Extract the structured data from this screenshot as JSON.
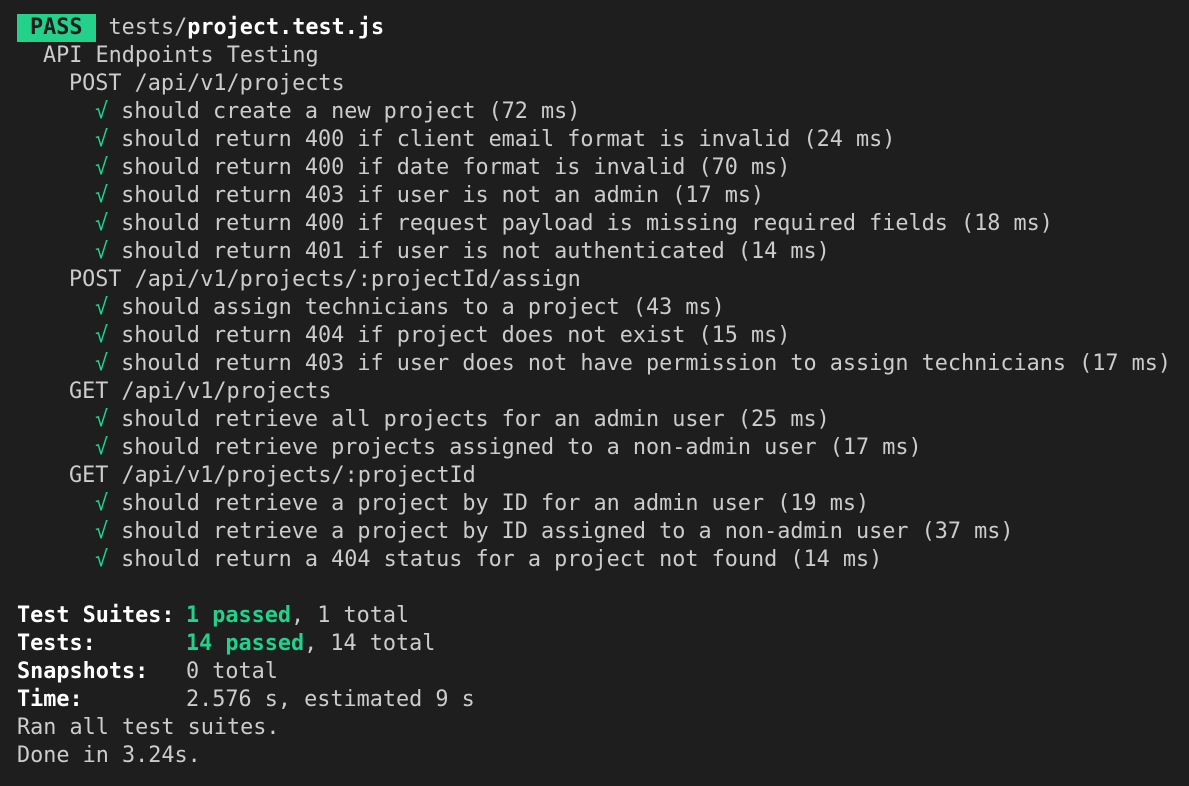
{
  "header": {
    "status": "PASS",
    "file_dir": "tests/",
    "file_name": "project.test.js"
  },
  "suite_title": "API Endpoints Testing",
  "check_glyph": "√",
  "groups": [
    {
      "title": "POST /api/v1/projects",
      "tests": [
        "should create a new project (72 ms)",
        "should return 400 if client email format is invalid (24 ms)",
        "should return 400 if date format is invalid (70 ms)",
        "should return 403 if user is not an admin (17 ms)",
        "should return 400 if request payload is missing required fields (18 ms)",
        "should return 401 if user is not authenticated (14 ms)"
      ]
    },
    {
      "title": "POST /api/v1/projects/:projectId/assign",
      "tests": [
        "should assign technicians to a project (43 ms)",
        "should return 404 if project does not exist (15 ms)",
        "should return 403 if user does not have permission to assign technicians (17 ms)"
      ]
    },
    {
      "title": "GET /api/v1/projects",
      "tests": [
        "should retrieve all projects for an admin user (25 ms)",
        "should retrieve projects assigned to a non-admin user (17 ms)"
      ]
    },
    {
      "title": "GET /api/v1/projects/:projectId",
      "tests": [
        "should retrieve a project by ID for an admin user (19 ms)",
        "should retrieve a project by ID assigned to a non-admin user (37 ms)",
        "should return a 404 status for a project not found (14 ms)"
      ]
    }
  ],
  "summary": {
    "suites_label": "Test Suites:",
    "suites_passed": "1 passed",
    "suites_rest": ", 1 total",
    "tests_label": "Tests:",
    "tests_passed": "14 passed",
    "tests_rest": ", 14 total",
    "snapshots_label": "Snapshots:",
    "snapshots_value": "0 total",
    "time_label": "Time:",
    "time_value": "2.576 s, estimated 9 s"
  },
  "footer": {
    "ran": "Ran all test suites.",
    "done": "Done in 3.24s."
  },
  "colors": {
    "background": "#1e1e1e",
    "pass": "#23d18b",
    "text": "#cccccc",
    "bold_text": "#ffffff"
  }
}
